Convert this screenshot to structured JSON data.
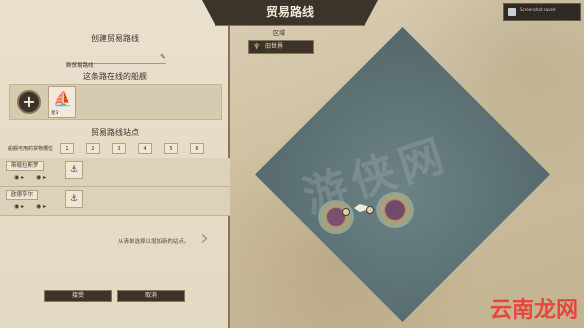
{
  "window": {
    "title": "贸易路线"
  },
  "left_panel": {
    "create_title": "创建贸易路线",
    "route_name": "新贸易路线",
    "ships_heading": "这条路在线的船舰",
    "add_ship_glyph": "+",
    "ship_label": "星3",
    "stations_heading": "贸易路线站点",
    "slots_label": "船舰可用的货物槽位",
    "slot_numbers": [
      "1",
      "2",
      "3",
      "4",
      "5",
      "6"
    ],
    "ports": [
      {
        "name": "斯窥拉斯罗"
      },
      {
        "name": "欧德亨尔"
      }
    ],
    "hint": "从清单选择以增加新的站点。"
  },
  "buttons": {
    "accept": "接受",
    "cancel": "取消"
  },
  "map": {
    "region_label": "区域",
    "region_name": "旧世界",
    "map_watermark": "游侠网"
  },
  "top_right": {
    "text": "Screenshot saved"
  },
  "watermark": "云南龙网",
  "colors": {
    "panel": "#e3d9c3",
    "dark": "#3c342b",
    "border": "#8a7456",
    "sea": "#5a6f72",
    "watermark": "#e5483a"
  }
}
